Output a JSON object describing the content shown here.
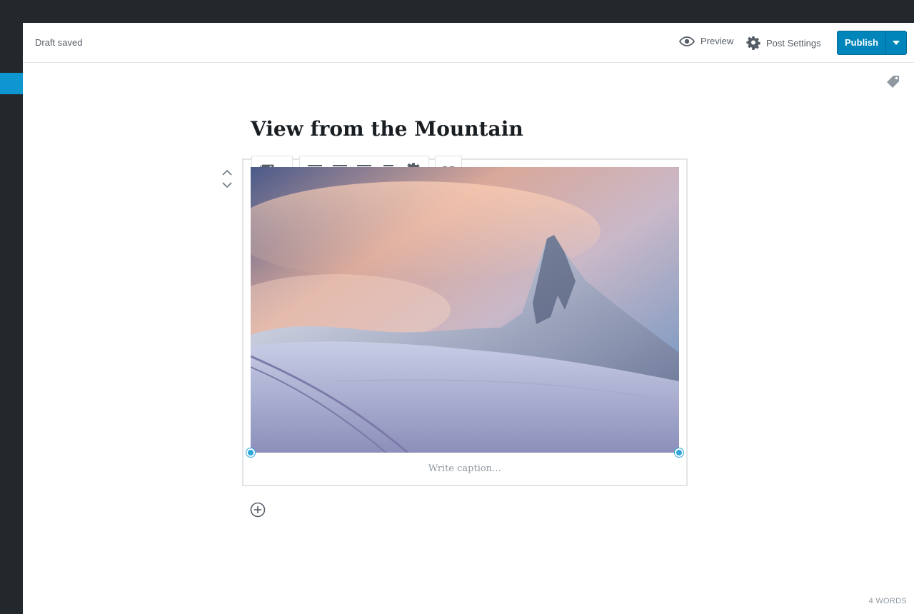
{
  "header": {
    "status": "Draft saved",
    "preview_label": "Preview",
    "settings_label": "Post Settings",
    "publish_label": "Publish"
  },
  "post": {
    "title": "View from the Mountain",
    "caption_placeholder": "Write caption…"
  },
  "footer": {
    "word_count": "4 WORDS"
  },
  "colors": {
    "admin_bar": "#23282d",
    "accent": "#0e96d1",
    "publish": "#0085ba",
    "handle": "#2fa6dc"
  },
  "icons": [
    "eye-icon",
    "gear-icon",
    "caret-down-icon",
    "tag-icon",
    "chevron-up-icon",
    "chevron-down-icon",
    "image-icon",
    "align-left-icon",
    "align-center-icon",
    "align-right-icon",
    "align-wide-icon",
    "link-icon",
    "plus-circle-icon"
  ]
}
